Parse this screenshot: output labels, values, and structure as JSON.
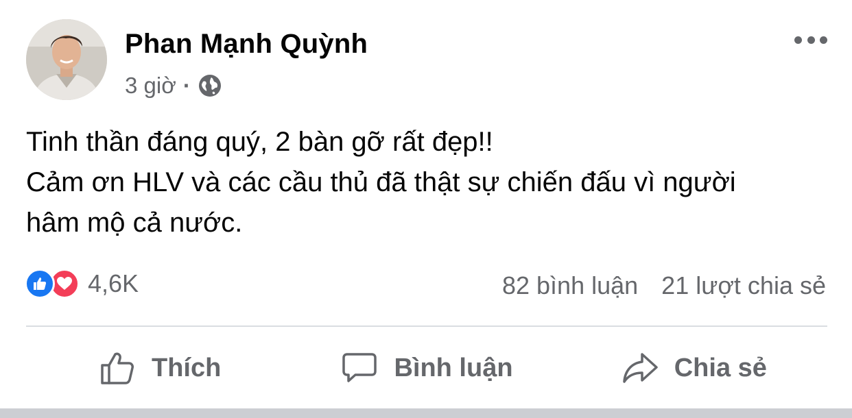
{
  "post": {
    "author": "Phan Mạnh Quỳnh",
    "time": "3 giờ",
    "separator": "·",
    "privacy_icon": "globe-icon",
    "more_icon": "more-options-icon",
    "content_lines": [
      "Tinh thần đáng quý, 2 bàn gỡ rất đẹp!!",
      "Cảm ơn HLV và các cầu thủ đã thật sự chiến đấu vì người",
      "hâm mộ cả nước."
    ]
  },
  "stats": {
    "reaction_icons": [
      "like-reaction-icon",
      "love-reaction-icon"
    ],
    "reaction_count": "4,6K",
    "comments": "82 bình luận",
    "shares": "21 lượt chia sẻ"
  },
  "actions": {
    "like": {
      "label": "Thích",
      "icon": "thumbs-up-icon"
    },
    "comment": {
      "label": "Bình luận",
      "icon": "comment-bubble-icon"
    },
    "share": {
      "label": "Chia sẻ",
      "icon": "share-arrow-icon"
    }
  },
  "colors": {
    "like_blue": "#1877f2",
    "love_red": "#f33e58",
    "secondary_text": "#65676b",
    "primary_text": "#050505",
    "divider": "#dadde1"
  }
}
